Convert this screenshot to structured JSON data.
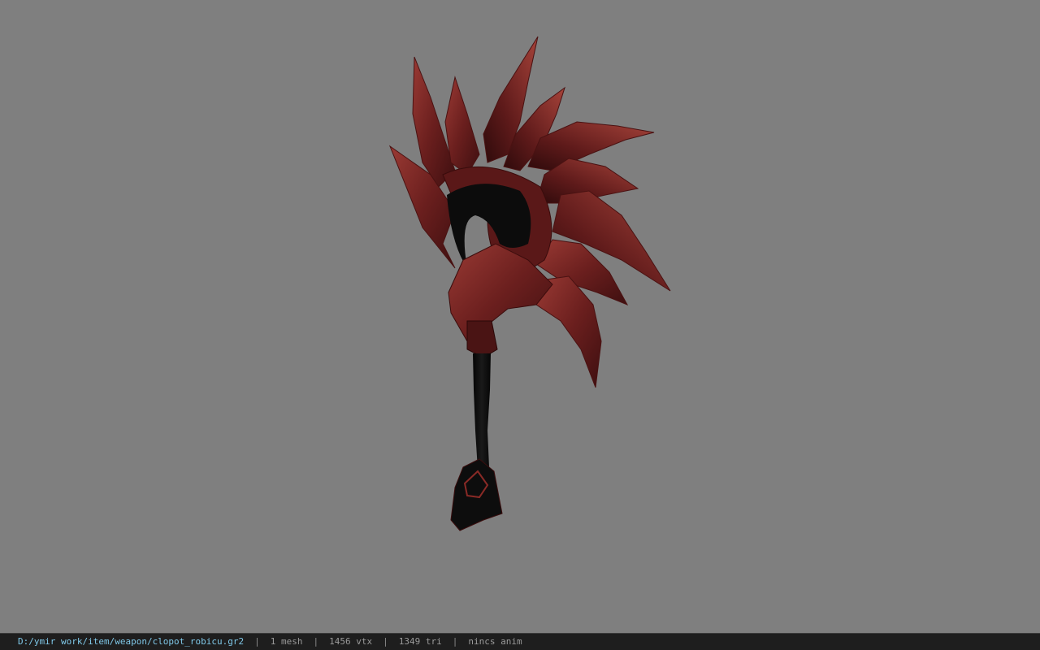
{
  "viewer": {
    "background_color": "#7f7f7f",
    "model": {
      "description_icon": "weapon-model",
      "blade_color": "#6b1f1e",
      "handle_color": "#0b0b0b"
    }
  },
  "statusbar": {
    "file_path": "D:/ymir work/item/weapon/clopot_robicu.gr2",
    "separator": "|",
    "mesh_count": "1 mesh",
    "vertex_count": "1456 vtx",
    "triangle_count": "1349 tri",
    "animation_status": "nincs anim"
  }
}
